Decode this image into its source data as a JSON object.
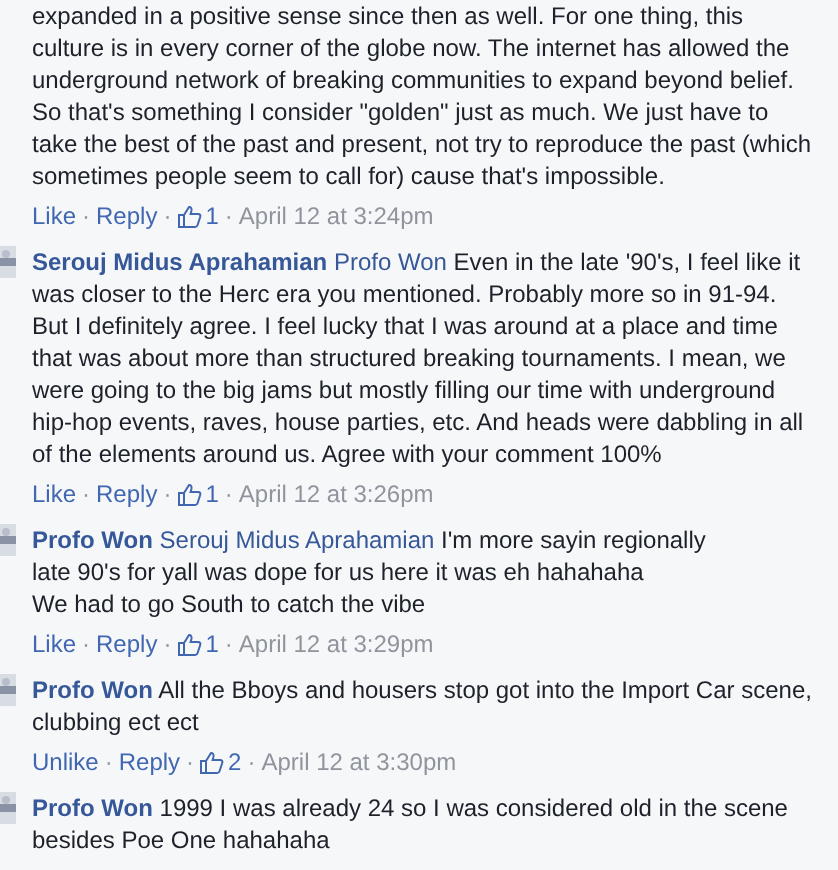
{
  "comments": [
    {
      "text": "expanded in a positive sense since then as well. For one thing, this culture is in every corner of the globe now. The internet has allowed the underground network of breaking communities to expand beyond belief. So that's something I consider \"golden\" just as much. We just have to take the best of the past and present, not try to reproduce the past (which sometimes people seem to call for) cause that's impossible.",
      "actions": {
        "like": "Like",
        "separator": "·",
        "reply": "Reply",
        "likes": "1",
        "time": "April 12 at 3:24pm"
      }
    },
    {
      "author": "Serouj Midus Aprahamian",
      "mention": "Profo Won",
      "text": "Even in the late '90's, I feel like it was closer to the Herc era you mentioned. Probably more so in 91-94. But I definitely agree. I feel lucky that I was around at a place and time that was about more than structured breaking tournaments. I mean, we were going to the big jams but mostly filling our time with underground hip-hop events, raves, house parties, etc. And heads were dabbling in all of the elements around us. Agree with your comment 100%",
      "actions": {
        "like": "Like",
        "separator": "·",
        "reply": "Reply",
        "likes": "1",
        "time": "April 12 at 3:26pm"
      }
    },
    {
      "author": "Profo Won",
      "mention": "Serouj Midus Aprahamian",
      "text": "I'm more sayin regionally\nlate 90's for yall was dope for us here it was eh hahahaha\nWe had to go South to catch the vibe",
      "actions": {
        "like": "Like",
        "separator": "·",
        "reply": "Reply",
        "likes": "1",
        "time": "April 12 at 3:29pm"
      }
    },
    {
      "author": "Profo Won",
      "text": "All the Bboys and housers stop got into the Import Car scene, clubbing ect ect",
      "actions": {
        "like": "Unlike",
        "separator": "·",
        "reply": "Reply",
        "likes": "2",
        "time": "April 12 at 3:30pm"
      }
    },
    {
      "author": "Profo Won",
      "text": "1999 I was already 24 so I was considered old in the scene besides Poe One hahahaha"
    }
  ]
}
